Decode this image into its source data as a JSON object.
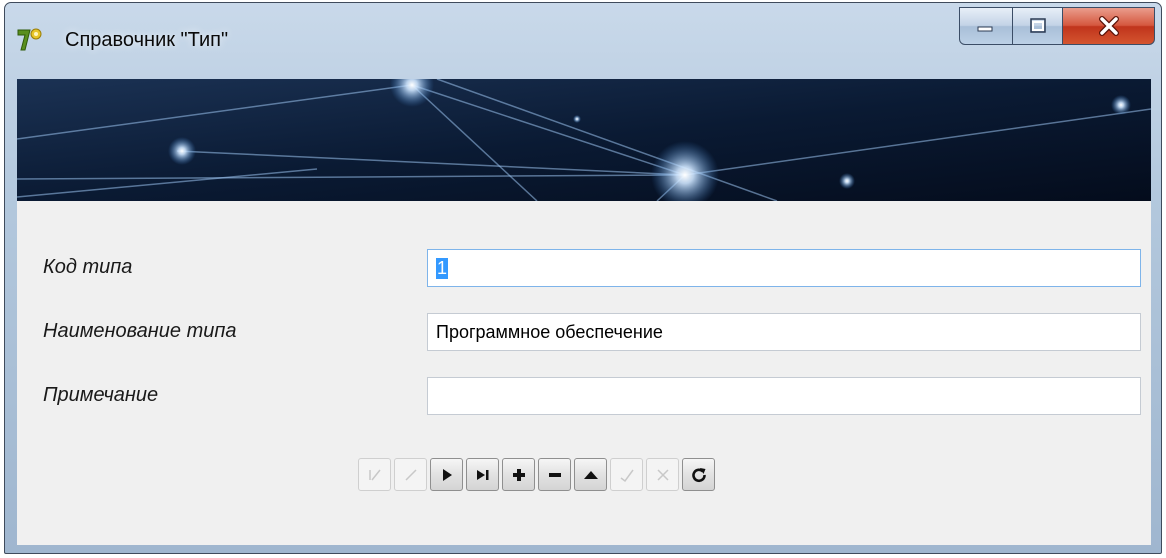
{
  "window": {
    "title": "Справочник \"Тип\"",
    "buttons": [
      "minimize",
      "maximize",
      "close"
    ]
  },
  "form": {
    "fields": [
      {
        "label": "Код типа",
        "value": "1",
        "selected": true
      },
      {
        "label": "Наименование типа",
        "value": "Программное обеспечение"
      },
      {
        "label": "Примечание",
        "value": ""
      }
    ]
  },
  "navigator": {
    "buttons": [
      {
        "name": "first",
        "icon": "first-record-icon",
        "enabled": false
      },
      {
        "name": "prior",
        "icon": "prior-record-icon",
        "enabled": false
      },
      {
        "name": "next",
        "icon": "next-record-icon",
        "enabled": true
      },
      {
        "name": "last",
        "icon": "last-record-icon",
        "enabled": true
      },
      {
        "name": "insert",
        "icon": "plus-icon",
        "enabled": true
      },
      {
        "name": "delete",
        "icon": "minus-icon",
        "enabled": true
      },
      {
        "name": "edit",
        "icon": "triangle-up-icon",
        "enabled": true
      },
      {
        "name": "post",
        "icon": "check-icon",
        "enabled": false
      },
      {
        "name": "cancel",
        "icon": "cancel-icon",
        "enabled": false
      },
      {
        "name": "refresh",
        "icon": "refresh-icon",
        "enabled": true
      }
    ]
  },
  "colors": {
    "selection": "#3399ff",
    "client_bg": "#f0f0f0",
    "close_button": "#c0341c"
  }
}
